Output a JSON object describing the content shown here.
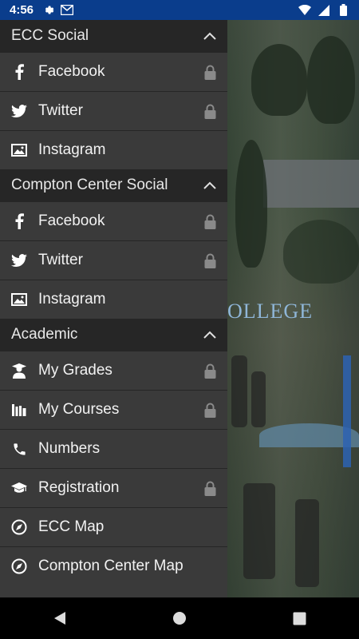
{
  "status_bar": {
    "time": "4:56",
    "icons_left": [
      "settings-icon",
      "gmail-icon"
    ],
    "icons_right": [
      "wifi-icon",
      "signal-icon",
      "battery-icon"
    ],
    "color": "#0a3d8c"
  },
  "background": {
    "college_text": "OLLEGE"
  },
  "drawer": {
    "sections": [
      {
        "title": "ECC Social",
        "items": [
          {
            "label": "Facebook",
            "icon": "facebook-icon",
            "locked": true
          },
          {
            "label": "Twitter",
            "icon": "twitter-icon",
            "locked": true
          },
          {
            "label": "Instagram",
            "icon": "image-icon",
            "locked": false
          }
        ]
      },
      {
        "title": "Compton Center Social",
        "items": [
          {
            "label": "Facebook",
            "icon": "facebook-icon",
            "locked": true
          },
          {
            "label": "Twitter",
            "icon": "twitter-icon",
            "locked": true
          },
          {
            "label": "Instagram",
            "icon": "image-icon",
            "locked": false
          }
        ]
      },
      {
        "title": "Academic",
        "items": [
          {
            "label": "My Grades",
            "icon": "graduate-icon",
            "locked": true
          },
          {
            "label": "My Courses",
            "icon": "books-icon",
            "locked": true
          },
          {
            "label": "Numbers",
            "icon": "phone-icon",
            "locked": false
          },
          {
            "label": "Registration",
            "icon": "mortarboard-icon",
            "locked": true
          },
          {
            "label": "ECC Map",
            "icon": "compass-icon",
            "locked": false
          },
          {
            "label": "Compton Center Map",
            "icon": "compass-icon",
            "locked": false
          }
        ]
      }
    ]
  },
  "nav_bar": {
    "buttons": [
      "back-icon",
      "home-icon",
      "recents-icon"
    ]
  }
}
